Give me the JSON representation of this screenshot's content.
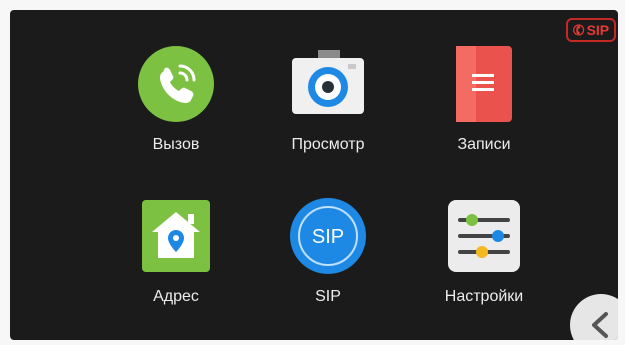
{
  "status": {
    "sip_label": "SIP",
    "sip_icon": "phone-icon",
    "color": "#c62828"
  },
  "menu": [
    {
      "id": "call",
      "label": "Вызов",
      "icon": "phone-call-icon"
    },
    {
      "id": "view",
      "label": "Просмотр",
      "icon": "camera-icon"
    },
    {
      "id": "records",
      "label": "Записи",
      "icon": "records-icon"
    },
    {
      "id": "address",
      "label": "Адрес",
      "icon": "home-location-icon"
    },
    {
      "id": "sip",
      "label": "SIP",
      "icon": "sip-icon",
      "badge": "SIP"
    },
    {
      "id": "settings",
      "label": "Настройки",
      "icon": "sliders-icon"
    }
  ],
  "back_button": {
    "icon": "chevron-left-icon"
  }
}
